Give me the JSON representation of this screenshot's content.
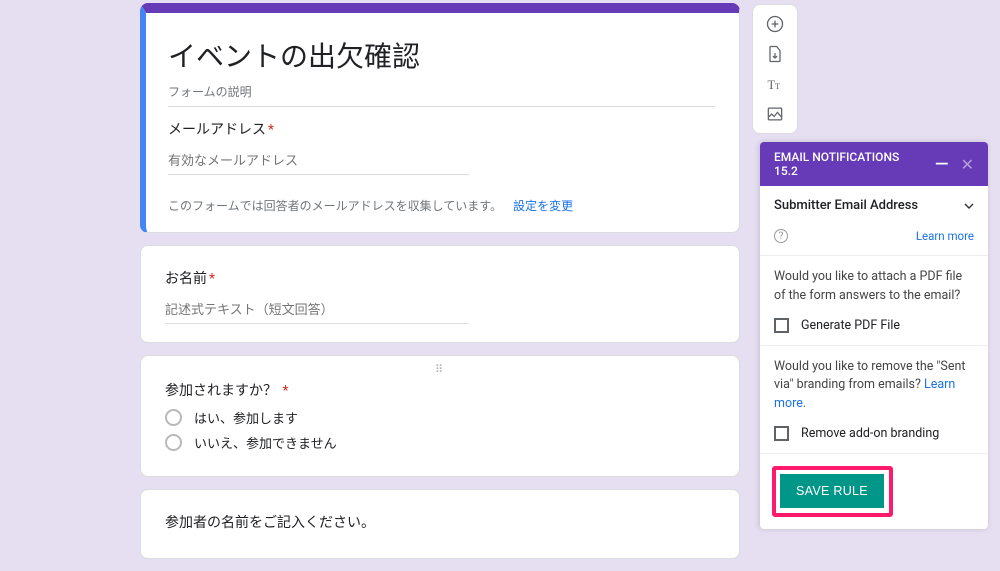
{
  "form": {
    "title": "イベントの出欠確認",
    "description_placeholder": "フォームの説明",
    "email_label": "メールアドレス",
    "email_placeholder": "有効なメールアドレス",
    "collect_note": "このフォームでは回答者のメールアドレスを収集しています。",
    "change_settings": "設定を変更",
    "name_label": "お名前",
    "name_placeholder": "記述式テキスト（短文回答）",
    "attend_label": "参加されますか？",
    "attend_options": [
      "はい、参加します",
      "いいえ、参加できません"
    ],
    "participant_label": "参加者の名前をご記入ください。"
  },
  "panel": {
    "title_line1": "EMAIL NOTIFICATIONS",
    "title_line2": "15.2",
    "dropdown_label": "Submitter Email Address",
    "learn_more": "Learn more",
    "pdf_question": "Would you like to attach a PDF file of the form answers to the email?",
    "pdf_checkbox": "Generate PDF File",
    "branding_question_prefix": "Would you like to remove the \"Sent via\" branding from emails? ",
    "branding_checkbox": "Remove add-on branding",
    "save_button": "SAVE RULE"
  }
}
